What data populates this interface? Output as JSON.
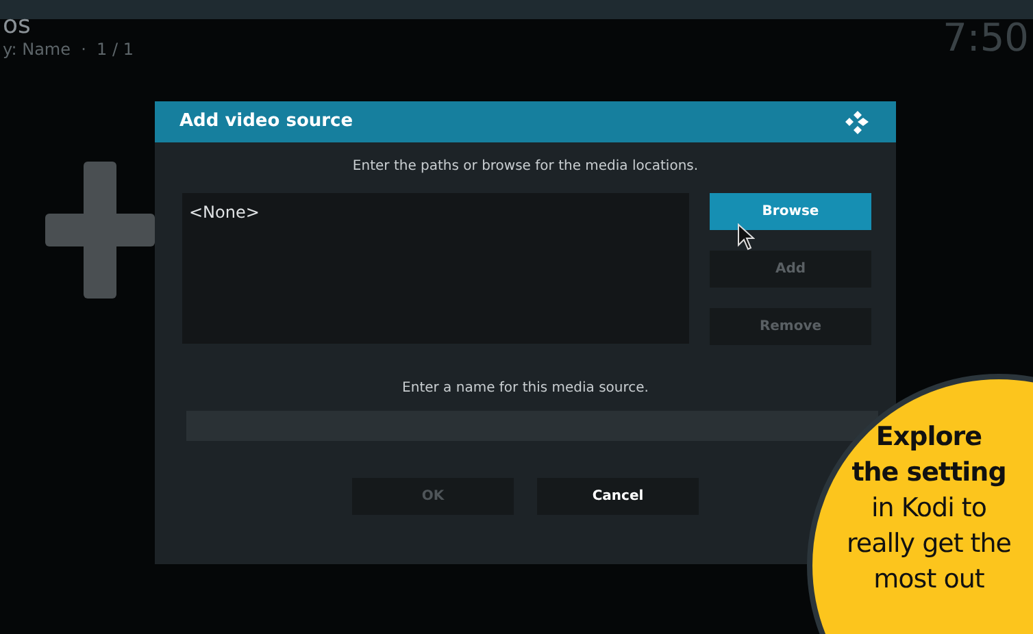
{
  "header": {
    "title_fragment": "os",
    "sort_info": "y: Name  ·  1 / 1",
    "clock": "7:50"
  },
  "dialog": {
    "title": "Add video source",
    "paths_hint": "Enter the paths or browse for the media locations.",
    "paths": [
      "<None>"
    ],
    "side_buttons": [
      {
        "label": "Browse",
        "focused": true,
        "disabled": false
      },
      {
        "label": "Add",
        "focused": false,
        "disabled": true
      },
      {
        "label": "Remove",
        "focused": false,
        "disabled": true
      }
    ],
    "name_hint": "Enter a name for this media source.",
    "buttons": [
      {
        "label": "OK",
        "disabled": true
      },
      {
        "label": "Cancel",
        "disabled": false
      }
    ]
  },
  "callout": {
    "lines": [
      {
        "text": "Explore",
        "bold": true
      },
      {
        "text": "the setting",
        "bold": true
      },
      {
        "text": "in Kodi to",
        "bold": false
      },
      {
        "text": "really get the",
        "bold": false
      },
      {
        "text": "most out",
        "bold": false
      }
    ]
  }
}
